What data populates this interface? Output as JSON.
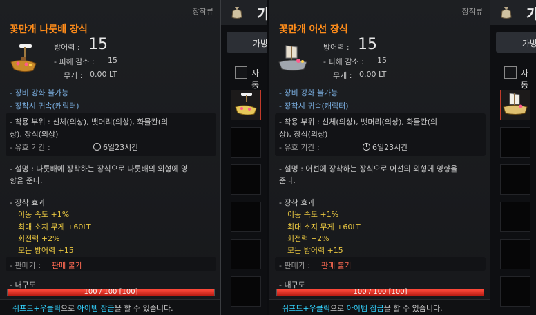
{
  "panels": [
    {
      "category": "장착류",
      "title": "꽃만개 나룻배 장식",
      "defense_label": "방어력 :",
      "defense_value": "15",
      "damage_reduction_label": "- 피해 감소 :",
      "damage_reduction_value": "15",
      "weight_label": "무게 :",
      "weight_value": "0.00 LT",
      "enhance": "- 장비 강화 불가능",
      "bind": "- 장착시 귀속(캐릭터)",
      "slots_line1": "- 착용 부위 : 선체(의상), 뱃머리(의상), 화물칸(의",
      "slots_line2": "상), 장식(의상)",
      "period_label": "- 유효 기간 :",
      "period_value": "6일23시간",
      "desc_line1": "- 설명 : 나룻배에 장착하는 장식으로 나룻배의 외형에 영",
      "desc_line2": "향을 준다.",
      "effect_title": "- 장착 효과",
      "effects": [
        "이동 속도 +1%",
        "최대 소지 무게 +60LT",
        "회전력 +2%",
        "모든 방어력 +15"
      ],
      "sell_label": "- 판매가 :",
      "sell_value": "판매 불가",
      "durability_label": "- 내구도",
      "durability_text": "100 / 100 [100]",
      "durability_fraction": 1.0,
      "footer_a": "쉬프트+우클릭",
      "footer_b": "으로 ",
      "footer_c": "아이템 잠금",
      "footer_d": "을 할 수 있습니다.",
      "inv_letter": "가",
      "inv_tab": "가방",
      "inv_check": "자동"
    },
    {
      "category": "장착류",
      "title": "꽃만개 어선 장식",
      "defense_label": "방어력 :",
      "defense_value": "15",
      "damage_reduction_label": "- 피해 감소 :",
      "damage_reduction_value": "15",
      "weight_label": "무게 :",
      "weight_value": "0.00 LT",
      "enhance": "- 장비 강화 불가능",
      "bind": "- 장착시 귀속(캐릭터)",
      "slots_line1": "- 착용 부위 : 선체(의상), 뱃머리(의상), 화물칸(의",
      "slots_line2": "상), 장식(의상)",
      "period_label": "- 유효 기간 :",
      "period_value": "6일23시간",
      "desc_line1": "- 설명 : 어선에 장착하는 장식으로 어선의 외형에 영향을",
      "desc_line2": "준다.",
      "effect_title": "- 장착 효과",
      "effects": [
        "이동 속도 +1%",
        "최대 소지 무게 +60LT",
        "회전력 +2%",
        "모든 방어력 +15"
      ],
      "sell_label": "- 판매가 :",
      "sell_value": "판매 불가",
      "durability_label": "- 내구도",
      "durability_text": "100 / 100 [100]",
      "durability_fraction": 1.0,
      "footer_a": "쉬프트+우클릭",
      "footer_b": "으로 ",
      "footer_c": "아이템 잠금",
      "footer_d": "을 할 수 있습니다.",
      "inv_letter": "가",
      "inv_tab": "가방",
      "inv_check": "자동"
    }
  ],
  "colors": {
    "title": "#ff8c1a",
    "blue_text": "#7aaee0",
    "effect": "#e8c640",
    "sell": "#ff6a52",
    "footer_highlight": "#33d3ff"
  },
  "icons": [
    "rowboat-decoration-icon",
    "fishing-boat-decoration-icon",
    "bag-icon",
    "clock-icon"
  ]
}
